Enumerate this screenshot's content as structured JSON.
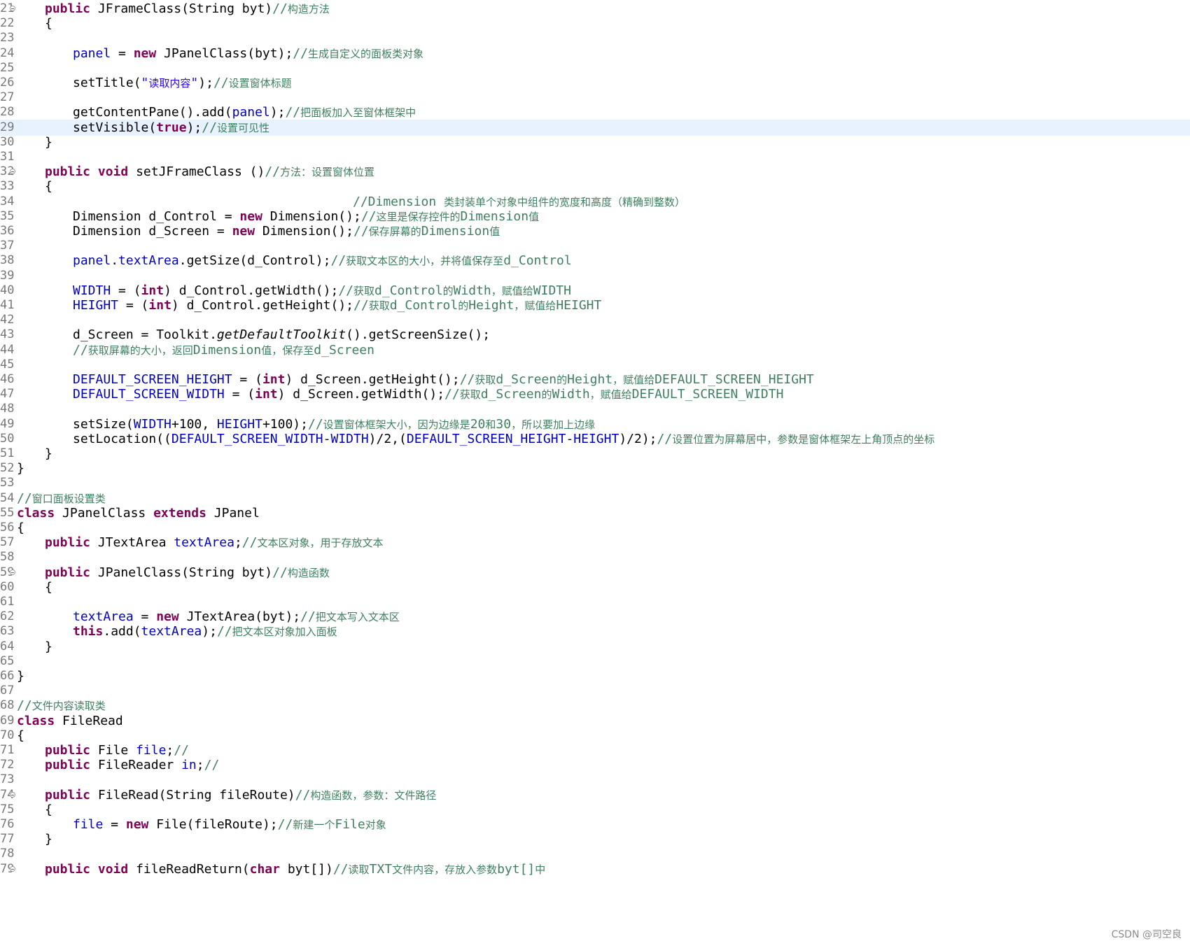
{
  "editor": {
    "lines": [
      {
        "num": "21",
        "fold": true,
        "indent": 1,
        "tokens": [
          [
            "kw",
            "public"
          ],
          [
            "plain",
            " JFrameClass(String "
          ],
          [
            "plain",
            "byt"
          ],
          [
            "plain",
            ")"
          ],
          [
            "comment",
            "//构造方法"
          ]
        ]
      },
      {
        "num": "22",
        "indent": 1,
        "tokens": [
          [
            "plain",
            "{"
          ]
        ]
      },
      {
        "num": "23",
        "tokens": []
      },
      {
        "num": "24",
        "indent": 2,
        "tokens": [
          [
            "field",
            "panel"
          ],
          [
            "plain",
            " = "
          ],
          [
            "kw",
            "new"
          ],
          [
            "plain",
            " JPanelClass(byt);"
          ],
          [
            "comment",
            "//生成自定义的面板类对象"
          ]
        ]
      },
      {
        "num": "25",
        "tokens": []
      },
      {
        "num": "26",
        "indent": 2,
        "tokens": [
          [
            "plain",
            "setTitle("
          ],
          [
            "str",
            "\"读取内容\""
          ],
          [
            "plain",
            ");"
          ],
          [
            "comment",
            "//设置窗体标题"
          ]
        ]
      },
      {
        "num": "27",
        "tokens": []
      },
      {
        "num": "28",
        "indent": 2,
        "tokens": [
          [
            "plain",
            "getContentPane().add("
          ],
          [
            "field",
            "panel"
          ],
          [
            "plain",
            ");"
          ],
          [
            "comment",
            "//把面板加入至窗体框架中"
          ]
        ]
      },
      {
        "num": "29",
        "highlight": true,
        "indent": 2,
        "tokens": [
          [
            "plain",
            "setVisible("
          ],
          [
            "kw",
            "true"
          ],
          [
            "plain",
            ");"
          ],
          [
            "comment",
            "//设置可见性"
          ]
        ]
      },
      {
        "num": "30",
        "indent": 1,
        "tokens": [
          [
            "plain",
            "}"
          ]
        ]
      },
      {
        "num": "31",
        "tokens": []
      },
      {
        "num": "32",
        "fold": true,
        "indent": 1,
        "tokens": [
          [
            "kw",
            "public"
          ],
          [
            "plain",
            " "
          ],
          [
            "kw",
            "void"
          ],
          [
            "plain",
            " setJFrameClass ()"
          ],
          [
            "comment",
            "//方法：设置窗体位置"
          ]
        ]
      },
      {
        "num": "33",
        "indent": 1,
        "tokens": [
          [
            "plain",
            "{"
          ]
        ]
      },
      {
        "num": "34",
        "indent": 12,
        "tokens": [
          [
            "comment",
            "//Dimension 类封装单个对象中组件的宽度和高度（精确到整数）"
          ]
        ]
      },
      {
        "num": "35",
        "indent": 2,
        "tokens": [
          [
            "plain",
            "Dimension d_Control = "
          ],
          [
            "kw",
            "new"
          ],
          [
            "plain",
            " Dimension();"
          ],
          [
            "comment",
            "//这里是保存控件的Dimension值"
          ]
        ]
      },
      {
        "num": "36",
        "indent": 2,
        "tokens": [
          [
            "plain",
            "Dimension d_Screen = "
          ],
          [
            "kw",
            "new"
          ],
          [
            "plain",
            " Dimension();"
          ],
          [
            "comment",
            "//保存屏幕的Dimension值"
          ]
        ]
      },
      {
        "num": "37",
        "tokens": []
      },
      {
        "num": "38",
        "indent": 2,
        "tokens": [
          [
            "field",
            "panel"
          ],
          [
            "plain",
            "."
          ],
          [
            "field",
            "textArea"
          ],
          [
            "plain",
            ".getSize(d_Control);"
          ],
          [
            "comment",
            "//获取文本区的大小，并将值保存至d_Control"
          ]
        ]
      },
      {
        "num": "39",
        "tokens": []
      },
      {
        "num": "40",
        "indent": 2,
        "tokens": [
          [
            "field",
            "WIDTH"
          ],
          [
            "plain",
            " = ("
          ],
          [
            "kw",
            "int"
          ],
          [
            "plain",
            ") d_Control.getWidth();"
          ],
          [
            "comment",
            "//获取d_Control的Width，赋值给WIDTH"
          ]
        ]
      },
      {
        "num": "41",
        "indent": 2,
        "tokens": [
          [
            "field",
            "HEIGHT"
          ],
          [
            "plain",
            " = ("
          ],
          [
            "kw",
            "int"
          ],
          [
            "plain",
            ") d_Control.getHeight();"
          ],
          [
            "comment",
            "//获取d_Control的Height，赋值给HEIGHT"
          ]
        ]
      },
      {
        "num": "42",
        "tokens": []
      },
      {
        "num": "43",
        "indent": 2,
        "tokens": [
          [
            "plain",
            "d_Screen = Toolkit."
          ],
          [
            "static",
            "getDefaultToolkit"
          ],
          [
            "plain",
            "().getScreenSize();"
          ]
        ]
      },
      {
        "num": "44",
        "indent": 2,
        "tokens": [
          [
            "comment",
            "//获取屏幕的大小，返回Dimension值，保存至d_Screen"
          ]
        ]
      },
      {
        "num": "45",
        "tokens": []
      },
      {
        "num": "46",
        "indent": 2,
        "tokens": [
          [
            "field",
            "DEFAULT_SCREEN_HEIGHT"
          ],
          [
            "plain",
            " = ("
          ],
          [
            "kw",
            "int"
          ],
          [
            "plain",
            ") d_Screen.getHeight();"
          ],
          [
            "comment",
            "//获取d_Screen的Height，赋值给DEFAULT_SCREEN_HEIGHT"
          ]
        ]
      },
      {
        "num": "47",
        "indent": 2,
        "tokens": [
          [
            "field",
            "DEFAULT_SCREEN_WIDTH"
          ],
          [
            "plain",
            " = ("
          ],
          [
            "kw",
            "int"
          ],
          [
            "plain",
            ") d_Screen.getWidth();"
          ],
          [
            "comment",
            "//获取d_Screen的Width，赋值给DEFAULT_SCREEN_WIDTH"
          ]
        ]
      },
      {
        "num": "48",
        "tokens": []
      },
      {
        "num": "49",
        "indent": 2,
        "tokens": [
          [
            "plain",
            "setSize("
          ],
          [
            "field",
            "WIDTH"
          ],
          [
            "plain",
            "+100, "
          ],
          [
            "field",
            "HEIGHT"
          ],
          [
            "plain",
            "+100);"
          ],
          [
            "comment",
            "//设置窗体框架大小，因为边缘是20和30，所以要加上边缘"
          ]
        ]
      },
      {
        "num": "50",
        "indent": 2,
        "tokens": [
          [
            "plain",
            "setLocation(("
          ],
          [
            "field",
            "DEFAULT_SCREEN_WIDTH"
          ],
          [
            "plain",
            "-"
          ],
          [
            "field",
            "WIDTH"
          ],
          [
            "plain",
            ")/2,("
          ],
          [
            "field",
            "DEFAULT_SCREEN_HEIGHT"
          ],
          [
            "plain",
            "-"
          ],
          [
            "field",
            "HEIGHT"
          ],
          [
            "plain",
            ")/2);"
          ],
          [
            "comment",
            "//设置位置为屏幕居中，参数是窗体框架左上角顶点的坐标"
          ]
        ]
      },
      {
        "num": "51",
        "indent": 1,
        "tokens": [
          [
            "plain",
            "}"
          ]
        ]
      },
      {
        "num": "52",
        "indent": 0,
        "tokens": [
          [
            "plain",
            "}"
          ]
        ]
      },
      {
        "num": "53",
        "tokens": []
      },
      {
        "num": "54",
        "indent": 0,
        "tokens": [
          [
            "comment",
            "//窗口面板设置类"
          ]
        ]
      },
      {
        "num": "55",
        "indent": 0,
        "tokens": [
          [
            "kw",
            "class"
          ],
          [
            "plain",
            " "
          ],
          [
            "squiggle",
            "JPanelClass"
          ],
          [
            "plain",
            " "
          ],
          [
            "kw",
            "extends"
          ],
          [
            "plain",
            " JPanel"
          ]
        ]
      },
      {
        "num": "56",
        "indent": 0,
        "tokens": [
          [
            "plain",
            "{"
          ]
        ]
      },
      {
        "num": "57",
        "indent": 1,
        "tokens": [
          [
            "kw",
            "public"
          ],
          [
            "plain",
            " JTextArea "
          ],
          [
            "field",
            "textArea"
          ],
          [
            "plain",
            ";"
          ],
          [
            "comment",
            "//文本区对象，用于存放文本"
          ]
        ]
      },
      {
        "num": "58",
        "tokens": []
      },
      {
        "num": "59",
        "fold": true,
        "indent": 1,
        "tokens": [
          [
            "kw",
            "public"
          ],
          [
            "plain",
            " JPanelClass(String byt)"
          ],
          [
            "comment",
            "//构造函数"
          ]
        ]
      },
      {
        "num": "60",
        "indent": 1,
        "tokens": [
          [
            "plain",
            "{"
          ]
        ]
      },
      {
        "num": "61",
        "tokens": []
      },
      {
        "num": "62",
        "indent": 2,
        "tokens": [
          [
            "field",
            "textArea"
          ],
          [
            "plain",
            " = "
          ],
          [
            "kw",
            "new"
          ],
          [
            "plain",
            " JTextArea(byt);"
          ],
          [
            "comment",
            "//把文本写入文本区"
          ]
        ]
      },
      {
        "num": "63",
        "indent": 2,
        "tokens": [
          [
            "kw",
            "this"
          ],
          [
            "plain",
            ".add("
          ],
          [
            "field",
            "textArea"
          ],
          [
            "plain",
            ");"
          ],
          [
            "comment",
            "//把文本区对象加入面板"
          ]
        ]
      },
      {
        "num": "64",
        "indent": 1,
        "tokens": [
          [
            "plain",
            "}"
          ]
        ]
      },
      {
        "num": "65",
        "tokens": []
      },
      {
        "num": "66",
        "indent": 0,
        "tokens": [
          [
            "plain",
            "}"
          ]
        ]
      },
      {
        "num": "67",
        "tokens": []
      },
      {
        "num": "68",
        "indent": 0,
        "tokens": [
          [
            "comment",
            "//文件内容读取类"
          ]
        ]
      },
      {
        "num": "69",
        "indent": 0,
        "tokens": [
          [
            "kw",
            "class"
          ],
          [
            "plain",
            " FileRead"
          ]
        ]
      },
      {
        "num": "70",
        "indent": 0,
        "tokens": [
          [
            "plain",
            "{"
          ]
        ]
      },
      {
        "num": "71",
        "indent": 1,
        "tokens": [
          [
            "kw",
            "public"
          ],
          [
            "plain",
            " File "
          ],
          [
            "field",
            "file"
          ],
          [
            "plain",
            ";"
          ],
          [
            "comment",
            "//"
          ]
        ]
      },
      {
        "num": "72",
        "indent": 1,
        "tokens": [
          [
            "kw",
            "public"
          ],
          [
            "plain",
            " FileReader "
          ],
          [
            "field",
            "in"
          ],
          [
            "plain",
            ";"
          ],
          [
            "comment",
            "//"
          ]
        ]
      },
      {
        "num": "73",
        "tokens": []
      },
      {
        "num": "74",
        "fold": true,
        "indent": 1,
        "tokens": [
          [
            "kw",
            "public"
          ],
          [
            "plain",
            " FileRead(String fileRoute)"
          ],
          [
            "comment",
            "//构造函数，参数：文件路径"
          ]
        ]
      },
      {
        "num": "75",
        "indent": 1,
        "tokens": [
          [
            "plain",
            "{"
          ]
        ]
      },
      {
        "num": "76",
        "indent": 2,
        "tokens": [
          [
            "field",
            "file"
          ],
          [
            "plain",
            " = "
          ],
          [
            "kw",
            "new"
          ],
          [
            "plain",
            " File(fileRoute);"
          ],
          [
            "comment",
            "//新建一个File对象"
          ]
        ]
      },
      {
        "num": "77",
        "indent": 1,
        "tokens": [
          [
            "plain",
            "}"
          ]
        ]
      },
      {
        "num": "78",
        "tokens": []
      },
      {
        "num": "79",
        "fold": true,
        "indent": 1,
        "tokens": [
          [
            "kw",
            "public"
          ],
          [
            "plain",
            " "
          ],
          [
            "kw",
            "void"
          ],
          [
            "plain",
            " fileReadReturn("
          ],
          [
            "kw",
            "char"
          ],
          [
            "plain",
            " byt[])"
          ],
          [
            "comment",
            "//读取TXT文件内容，存放入参数byt[]中"
          ]
        ]
      }
    ]
  },
  "watermark": {
    "text": "CSDN @司空良"
  },
  "colors": {
    "keyword": "#7f0055",
    "field": "#0000c0",
    "string": "#2a00ff",
    "comment": "#3f7f5f",
    "current_line": "#e8f2fe",
    "line_number": "#787878"
  }
}
